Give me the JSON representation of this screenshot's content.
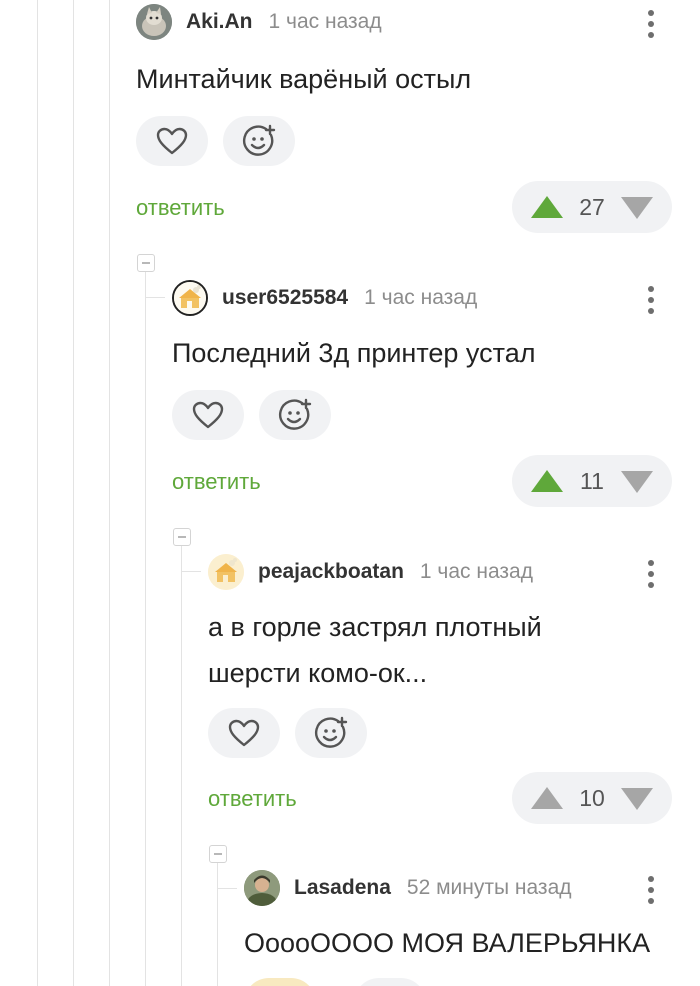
{
  "comments": [
    {
      "author": "Aki.An",
      "time": "1 час назад",
      "text": "Минтайчик варёный остыл",
      "reply": "ответить",
      "rating": "27",
      "vote": "up",
      "avatar": "cat-photo-avatar"
    },
    {
      "author": "user6525584",
      "time": "1 час назад",
      "text": "Последний 3д принтер устал",
      "reply": "ответить",
      "rating": "11",
      "vote": "up",
      "avatar": "default-house-avatar"
    },
    {
      "author": "peajackboatan",
      "time": "1 час назад",
      "text": "а в горле застрял плотный шерсти комо-ок...",
      "reply": "ответить",
      "rating": "10",
      "vote": "none",
      "avatar": "default-house-avatar"
    },
    {
      "author": "Lasadena",
      "time": "52 минуты назад",
      "text": "ОоооОООО МОЯ ВАЛЕРЬЯНКА",
      "avatar": "person-photo-avatar"
    }
  ],
  "icons": {
    "like": "heart-icon",
    "react": "smiley-add-icon",
    "menu": "kebab-menu-icon",
    "upvote": "upvote-triangle-icon",
    "downvote": "downvote-triangle-icon",
    "collapse": "collapse-thread-icon"
  },
  "colors": {
    "reply": "#5fa83a",
    "upvote_active": "#5fa83a",
    "vote_inactive": "#a6a6a6",
    "pill_bg": "#f1f2f4",
    "text": "#222222",
    "meta": "#8c8c8c"
  }
}
